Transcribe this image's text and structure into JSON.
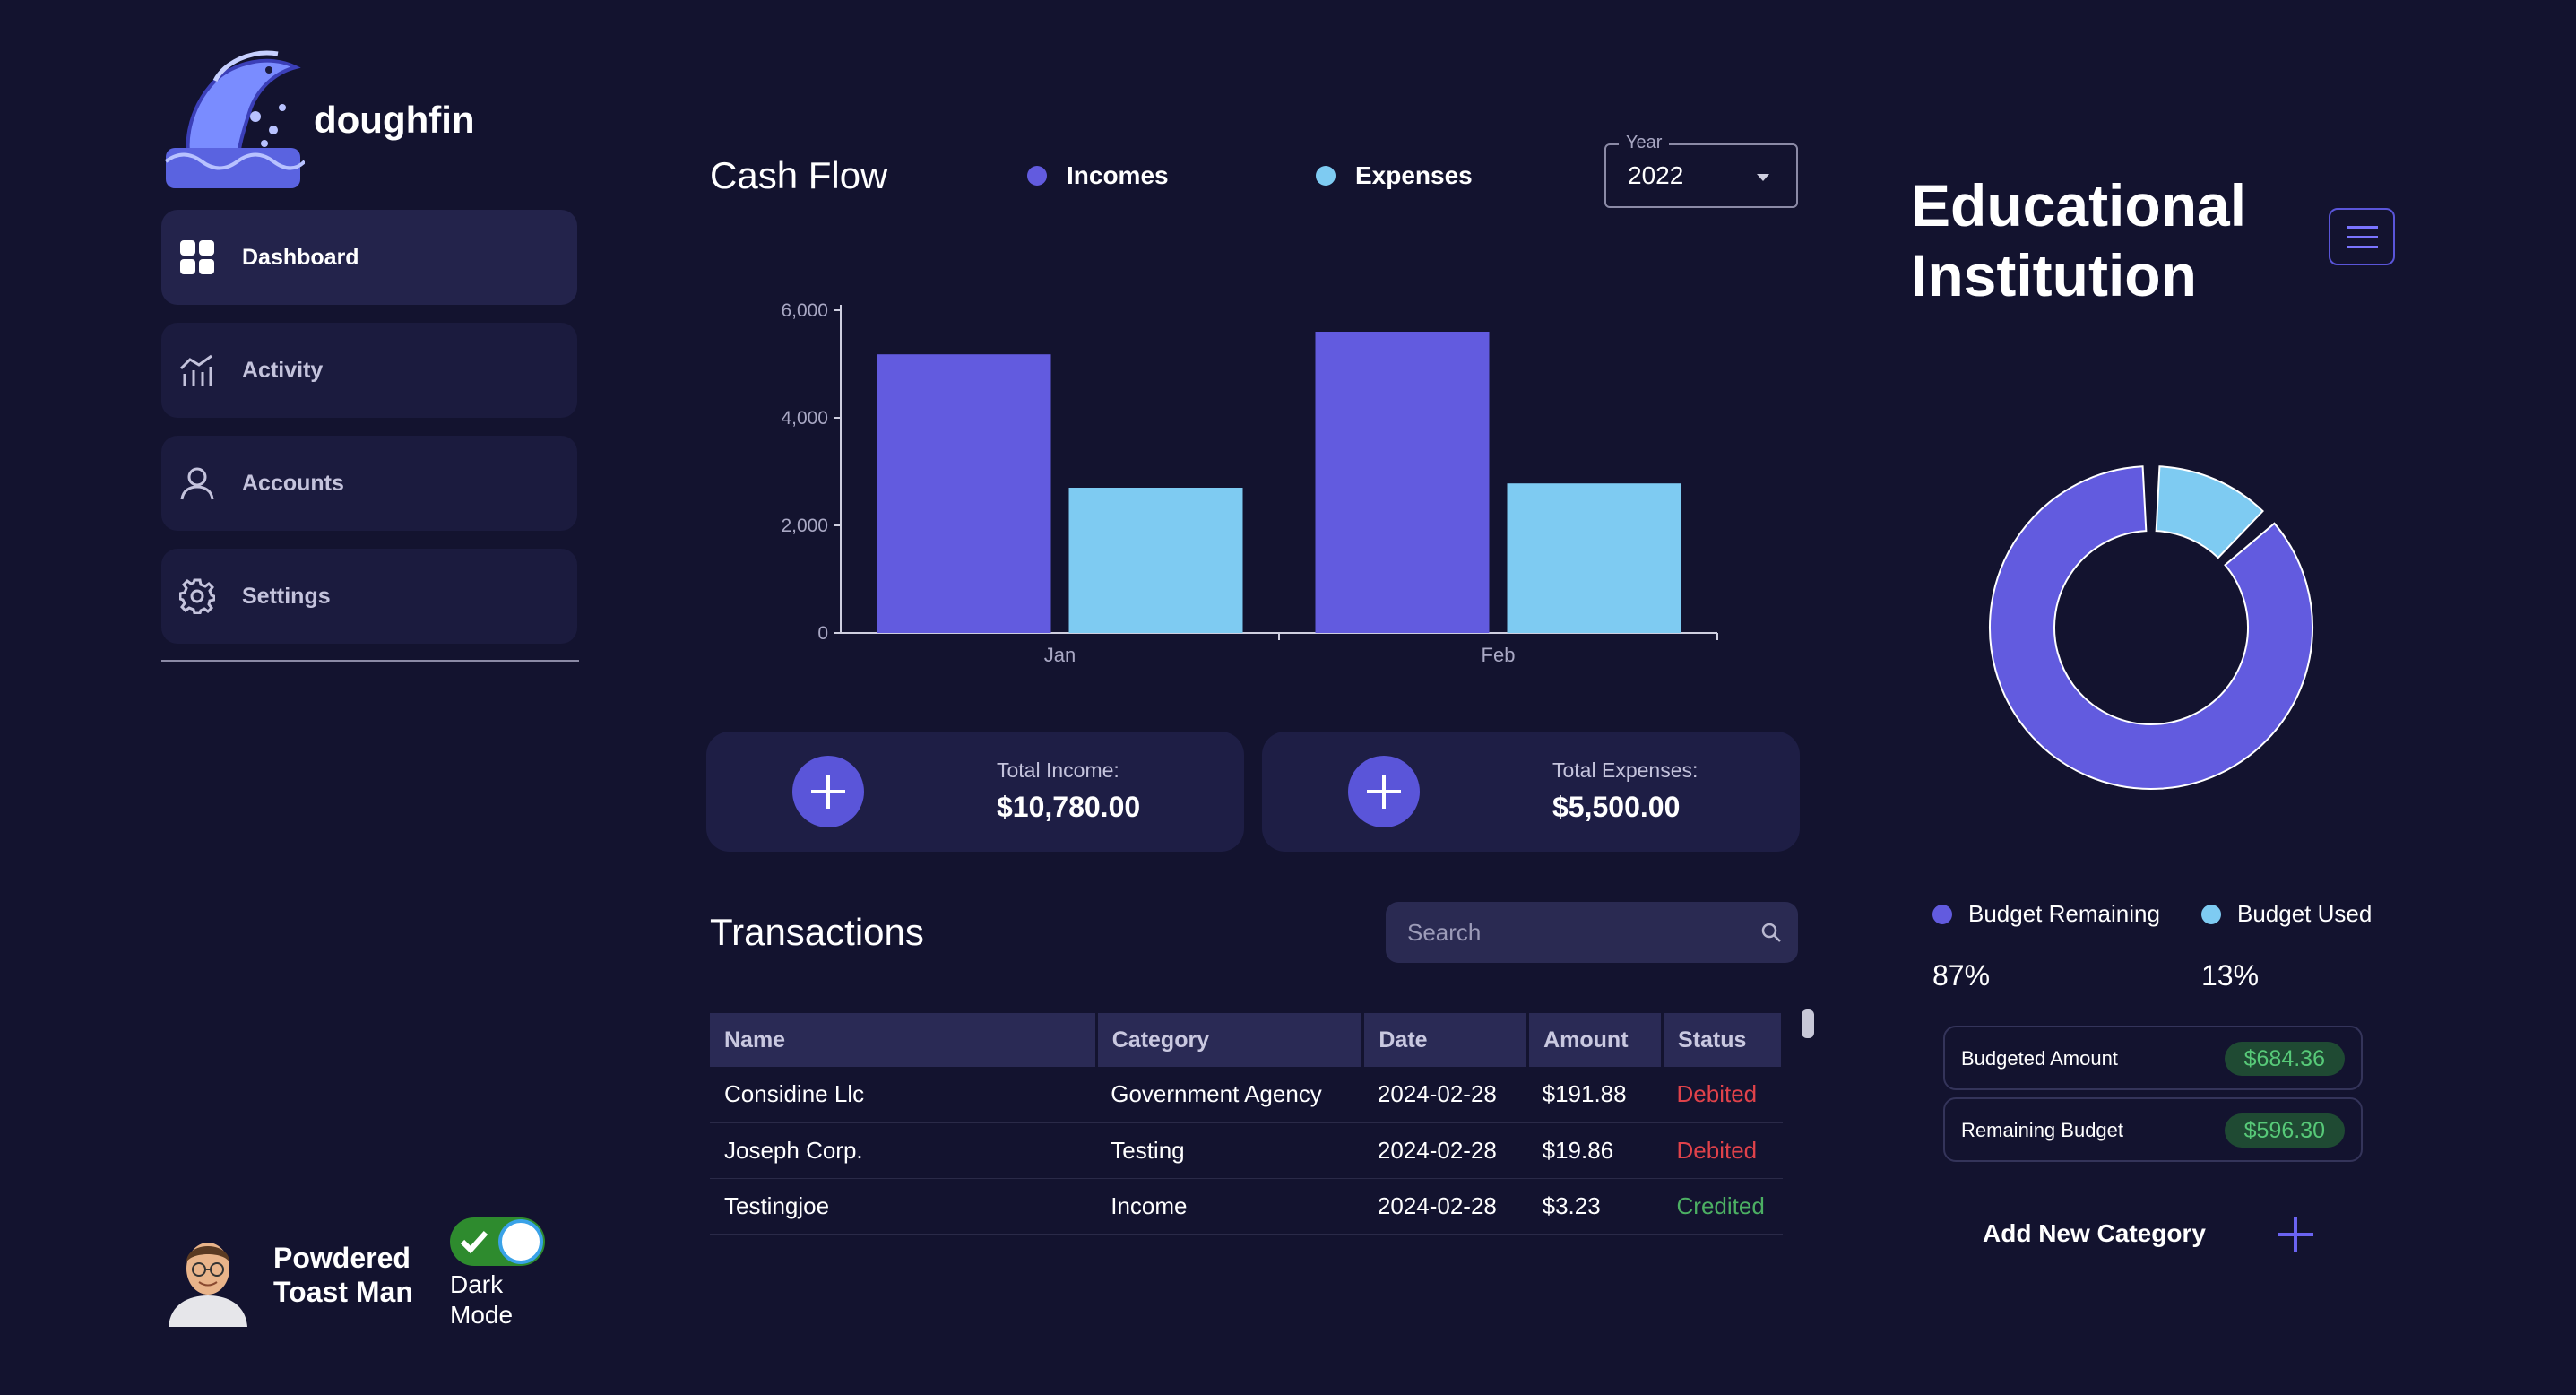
{
  "brand": {
    "name": "doughfin"
  },
  "sidebar": {
    "items": [
      {
        "label": "Dashboard",
        "icon": "grid-icon",
        "active": true
      },
      {
        "label": "Activity",
        "icon": "activity-icon",
        "active": false
      },
      {
        "label": "Accounts",
        "icon": "user-icon",
        "active": false
      },
      {
        "label": "Settings",
        "icon": "gear-icon",
        "active": false
      }
    ]
  },
  "user": {
    "name": "Powdered Toast Man",
    "dark_mode_label": "Dark Mode",
    "dark_mode": true
  },
  "cashflow": {
    "title": "Cash Flow",
    "legend": [
      {
        "label": "Incomes",
        "color": "#625bdf"
      },
      {
        "label": "Expenses",
        "color": "#7ecbf2"
      }
    ],
    "year_label": "Year",
    "year_value": "2022"
  },
  "chart_data": {
    "type": "bar",
    "categories": [
      "Jan",
      "Feb"
    ],
    "series": [
      {
        "name": "Incomes",
        "values": [
          5180,
          5600
        ],
        "color": "#625bdf"
      },
      {
        "name": "Expenses",
        "values": [
          2700,
          2780
        ],
        "color": "#7ecbf2"
      }
    ],
    "yticks": [
      "0",
      "2,000",
      "4,000",
      "6,000"
    ],
    "ylim": [
      0,
      6000
    ],
    "grid": false
  },
  "stats": {
    "income": {
      "label": "Total Income:",
      "value": "$10,780.00"
    },
    "expenses": {
      "label": "Total Expenses:",
      "value": "$5,500.00"
    }
  },
  "transactions": {
    "title": "Transactions",
    "search_placeholder": "Search",
    "columns": [
      "Name",
      "Category",
      "Date",
      "Amount",
      "Status"
    ],
    "rows": [
      {
        "name": "Considine Llc",
        "category": "Government Agency",
        "date": "2024-02-28",
        "amount": "$191.88",
        "status": "Debited"
      },
      {
        "name": "Joseph Corp.",
        "category": "Testing",
        "date": "2024-02-28",
        "amount": "$19.86",
        "status": "Debited"
      },
      {
        "name": "Testingjoe",
        "category": "Income",
        "date": "2024-02-28",
        "amount": "$3.23",
        "status": "Credited"
      }
    ]
  },
  "budget": {
    "title": "Educational Institution",
    "legend": [
      {
        "label": "Budget Remaining",
        "color": "#625bdf",
        "percent": "87%",
        "fraction": 0.87
      },
      {
        "label": "Budget Used",
        "color": "#7ecbf2",
        "percent": "13%",
        "fraction": 0.13
      }
    ],
    "budgeted_amount": {
      "label": "Budgeted Amount",
      "value": "$684.36"
    },
    "remaining_budget": {
      "label": "Remaining Budget",
      "value": "$596.30"
    },
    "add_category_label": "Add New Category"
  }
}
